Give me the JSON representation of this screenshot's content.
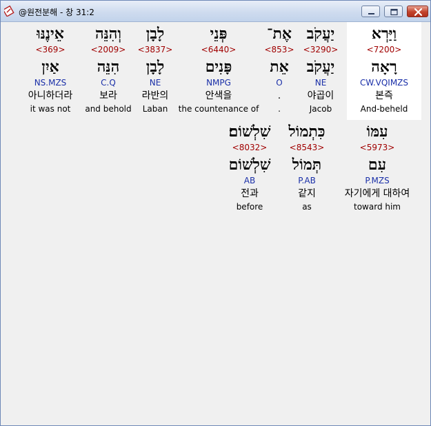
{
  "window": {
    "title": "@원전분해 - 창 31:2",
    "icon": "bible-app-icon",
    "controls": [
      "minimize-icon",
      "maximize-icon",
      "close-icon"
    ]
  },
  "verse_rows": [
    [
      {
        "hebrew": "וַיַּרְא",
        "strong": "<7200>",
        "lemma": "רָאָה",
        "morph": "CW.VQIMZS",
        "korean": "본즉",
        "english": "And-beheld",
        "highlighted": true
      },
      {
        "hebrew": "יַעֲקֹב",
        "strong": "<3290>",
        "lemma": "יַעֲקֹב",
        "morph": "NE",
        "korean": "야곱이",
        "english": "Jacob"
      },
      {
        "hebrew": "אֶת־",
        "strong": "<853>",
        "lemma": "אֵת",
        "morph": "O",
        "korean": ".",
        "english": "."
      },
      {
        "hebrew": "פְּנֵי",
        "strong": "<6440>",
        "lemma": "פָּנִים",
        "morph": "NMPG",
        "korean": "안색을",
        "english": "the countenance of"
      },
      {
        "hebrew": "לָבָן",
        "strong": "<3837>",
        "lemma": "לָבָן",
        "morph": "NE",
        "korean": "라반의",
        "english": "Laban"
      },
      {
        "hebrew": "וְהִנֵּה",
        "strong": "<2009>",
        "lemma": "הִנֵּה",
        "morph": "C.Q",
        "korean": "보라",
        "english": "and behold"
      },
      {
        "hebrew": "אֵינֶנּוּ",
        "strong": "<369>",
        "lemma": "אַיִן",
        "morph": "NS.MZS",
        "korean": "아니하더라",
        "english": "it was not"
      }
    ],
    [
      {
        "hebrew": "עִמּוֹ",
        "strong": "<5973>",
        "lemma": "עִם",
        "morph": "P.MZS",
        "korean": "자기에게 대하여",
        "english": "toward him"
      },
      {
        "hebrew": "כִּתְמוֹל",
        "strong": "<8543>",
        "lemma": "תְּמוֹל",
        "morph": "P.AB",
        "korean": "같지",
        "english": "as"
      },
      {
        "hebrew": "שִׁלְשׁוֹם׃",
        "strong": "<8032>",
        "lemma": "שִׁלְשׁוֹם",
        "morph": "AB",
        "korean": "전과",
        "english": "before"
      }
    ]
  ]
}
